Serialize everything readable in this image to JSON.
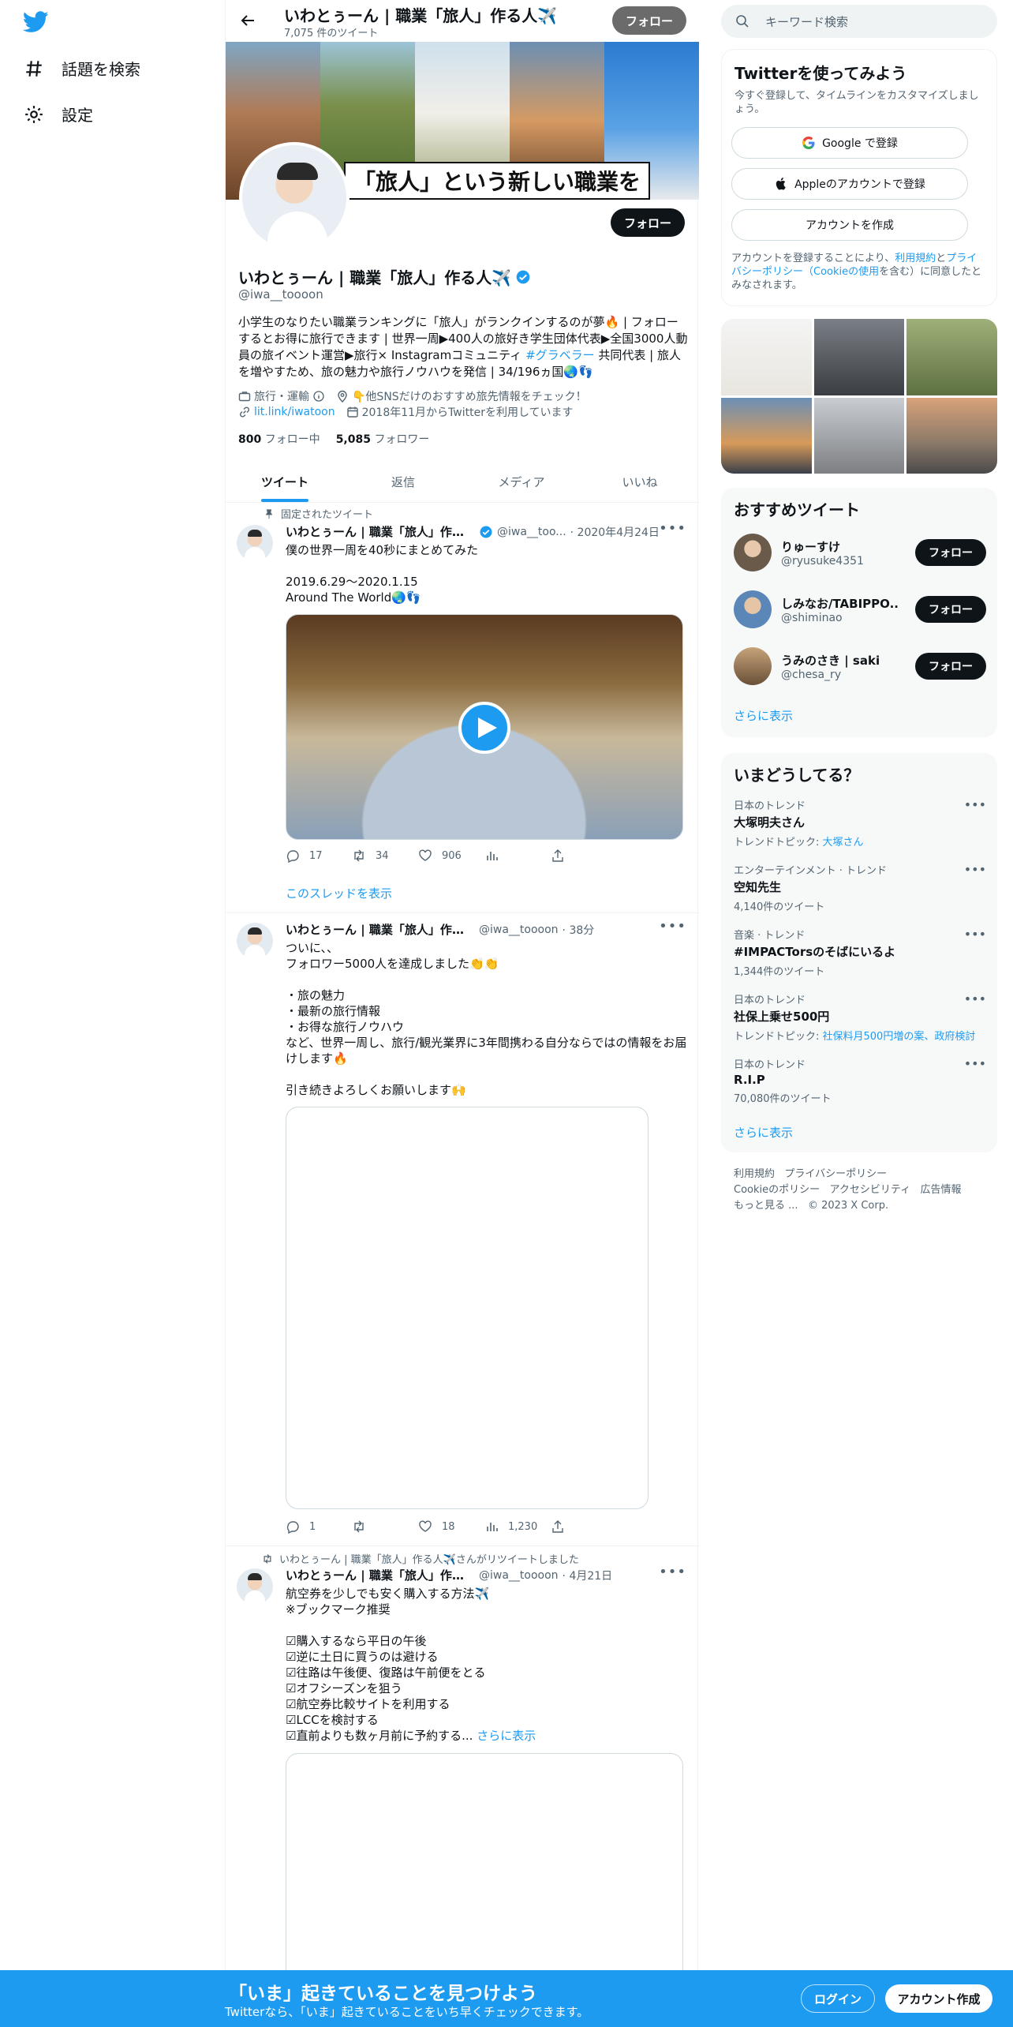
{
  "nav": {
    "explore_label": "話題を検索",
    "settings_label": "設定"
  },
  "topbar": {
    "title": "いわとぅーん | 職業「旅人」作る人✈️",
    "tweet_count": "7,075 件のツイート",
    "follow_label": "フォロー"
  },
  "banner": {
    "text": "「旅人」という新しい職業を"
  },
  "profile": {
    "name": "いわとぅーん | 職業「旅人」作る人✈️",
    "handle": "@iwa__toooon",
    "follow_label": "フォロー",
    "bio_text": "小学生のなりたい職業ランキングに「旅人」がランクインするのが夢🔥 | フォローするとお得に旅行できます | 世界一周▶400人の旅好き学生団体代表▶全国3000人動員の旅イベント運営▶旅行× Instagramコミュニティ ",
    "bio_hashtag": "#グラベラー",
    "bio_text2": " 共同代表 | 旅人を増やすため、旅の魅力や旅行ノウハウを発信 | 34/196ヵ国🌏👣",
    "category": "旅行・運輸",
    "location": "👇他SNSだけのおすすめ旅先情報をチェック！",
    "url": "lit.link/iwatoon",
    "joined": "2018年11月からTwitterを利用しています",
    "following_count": "800",
    "following_label": "フォロー中",
    "followers_count": "5,085",
    "followers_label": "フォロワー"
  },
  "tabs": [
    "ツイート",
    "返信",
    "メディア",
    "いいね"
  ],
  "tweets": [
    {
      "social": "固定されたツイート",
      "name": "いわとぅーん | 職業「旅人」作る...",
      "handle": "@iwa__too...",
      "time": "· 2020年4月24日",
      "body": "僕の世界一周を40秒にまとめてみた\n\n2019.6.29〜2020.1.15\nAround The World🌏👣",
      "replies": "17",
      "retweets": "34",
      "likes": "906",
      "views": "",
      "thread_link": "このスレッドを表示"
    },
    {
      "name": "いわとぅーん | 職業「旅人」作る人✈️",
      "handle": "@iwa__toooon",
      "time": "· 38分",
      "body": "ついに、、\nフォロワー5000人を達成しました👏👏\n\n・旅の魅力\n・最新の旅行情報\n・お得な旅行ノウハウ\nなど、世界一周し、旅行/観光業界に3年間携わる自分ならではの情報をお届けします🔥\n\n引き続きよろしくお願いします🙌",
      "replies": "1",
      "retweets": "",
      "likes": "18",
      "views": "1,230"
    },
    {
      "social": "いわとぅーん | 職業「旅人」作る人✈️さんがリツイートしました",
      "name": "いわとぅーん | 職業「旅人」作る人✈️",
      "handle": "@iwa__toooon",
      "time": "· 4月21日",
      "body": "航空券を少しでも安く購入する方法✈️\n※ブックマーク推奨\n\n☑︎購入するなら平日の午後\n☑︎逆に土日に買うのは避ける\n☑︎往路は午後便、復路は午前便をとる\n☑︎オフシーズンを狙う\n☑︎航空券比較サイトを利用する\n☑︎LCCを検討する\n☑︎直前よりも数ヶ月前に予約する...",
      "show_more": "さらに表示"
    }
  ],
  "search": {
    "placeholder": "キーワード検索"
  },
  "signup": {
    "title": "Twitterを使ってみよう",
    "subtitle": "今すぐ登録して、タイムラインをカスタマイズしましょう。",
    "google_label": "Google で登録",
    "apple_label": "Appleのアカウントで登録",
    "create_label": "アカウントを作成",
    "legal_1": "アカウントを登録することにより、",
    "legal_terms": "利用規約",
    "legal_2": "と",
    "legal_privacy": "プライバシーポリシー",
    "legal_3": "（",
    "legal_cookie": "Cookieの使用",
    "legal_4": "を含む）に同意したとみなされます。"
  },
  "recommended": {
    "title": "おすすめツイート",
    "users": [
      {
        "name": "りゅーすけ",
        "handle": "@ryusuke4351"
      },
      {
        "name": "しみなお/TABIPPO...",
        "handle": "@shiminao"
      },
      {
        "name": "うみのさき | saki",
        "handle": "@chesa_ry"
      }
    ],
    "follow_label": "フォロー",
    "more_label": "さらに表示"
  },
  "trends": {
    "title": "いまどうしてる？",
    "items": [
      {
        "context": "日本のトレンド",
        "topic": "大塚明夫さん",
        "sub": "トレンドトピック: ",
        "sub_link": "大塚さん"
      },
      {
        "context": "エンターテインメント · トレンド",
        "topic": "空知先生",
        "sub": "4,140件のツイート"
      },
      {
        "context": "音楽 · トレンド",
        "topic": "#IMPACTorsのそばにいるよ",
        "sub": "1,344件のツイート"
      },
      {
        "context": "日本のトレンド",
        "topic": "社保上乗せ500円",
        "sub": "トレンドトピック: ",
        "sub_link": "社保料月500円増の案、政府検討"
      },
      {
        "context": "日本のトレンド",
        "topic": "R.I.P",
        "sub": "70,080件のツイート"
      }
    ],
    "more_label": "さらに表示"
  },
  "footer": {
    "links": [
      "利用規約",
      "プライバシーポリシー",
      "Cookieのポリシー",
      "アクセシビリティ",
      "広告情報",
      "もっと見る ..."
    ],
    "copyright": "© 2023 X Corp."
  },
  "bottom_bar": {
    "title": "「いま」起きていることを見つけよう",
    "subtitle": "Twitterなら、「いま」起きていることをいち早くチェックできます。",
    "login_label": "ログイン",
    "signup_label": "アカウント作成"
  },
  "colors": {
    "accent": "#1d9bf0",
    "text": "#0f1419",
    "secondary": "#536471"
  }
}
